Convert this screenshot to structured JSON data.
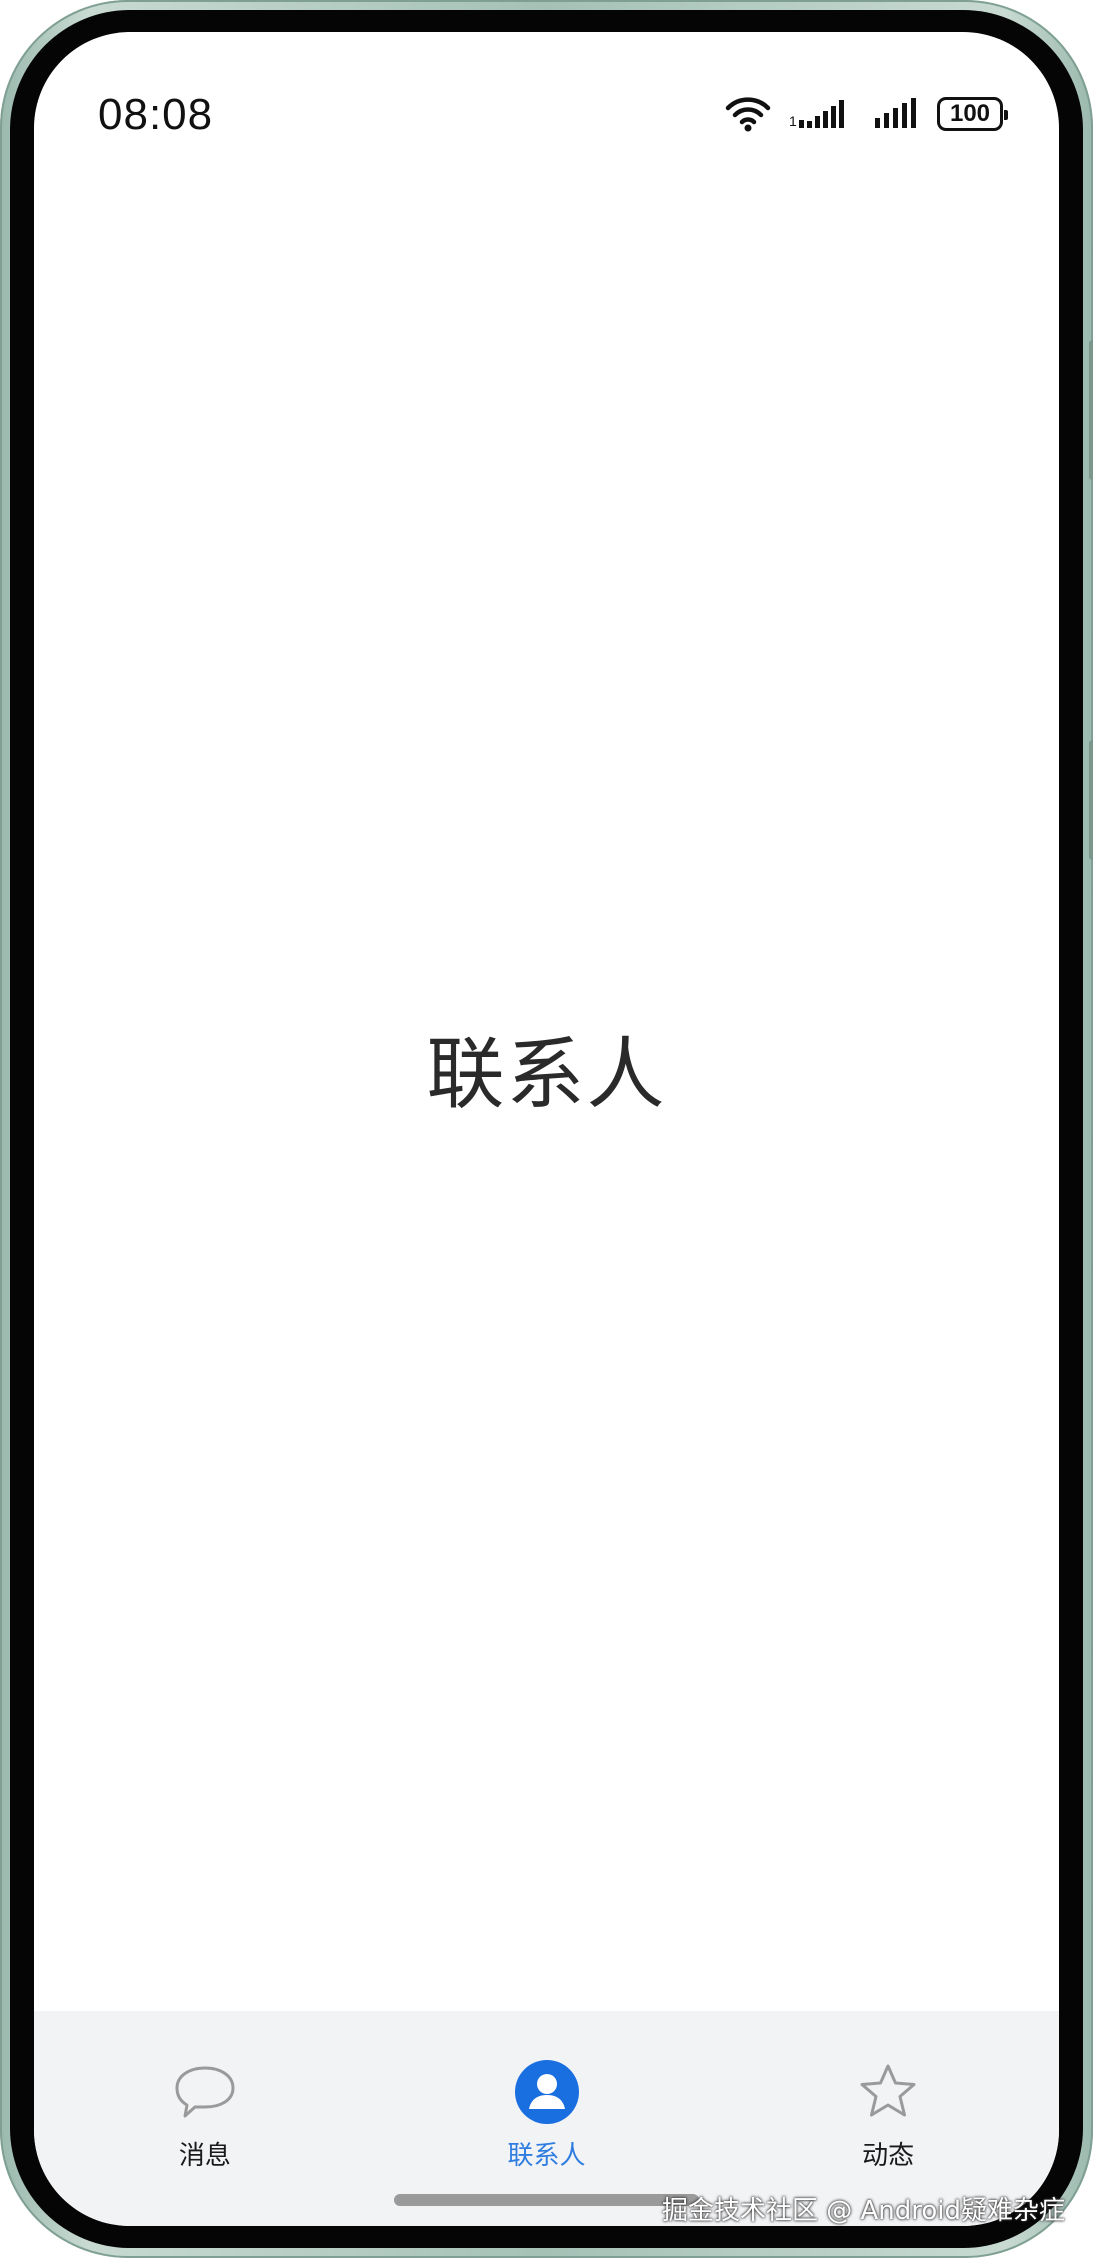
{
  "status_bar": {
    "time": "08:08",
    "battery_level": "100",
    "icons": [
      "wifi-icon",
      "signal-icon-sim1",
      "signal-icon-sim2",
      "battery-icon"
    ]
  },
  "page": {
    "title": "联系人"
  },
  "bottom_nav": {
    "active_index": 1,
    "items": [
      {
        "label": "消息",
        "icon": "chat-bubble-icon"
      },
      {
        "label": "联系人",
        "icon": "contact-person-icon"
      },
      {
        "label": "动态",
        "icon": "star-icon"
      }
    ]
  },
  "watermark": "掘金技术社区 @ Android疑难杂症",
  "colors": {
    "accent": "#2f7de1",
    "nav_background": "#f2f3f5",
    "frame": "#a5c1b6"
  }
}
